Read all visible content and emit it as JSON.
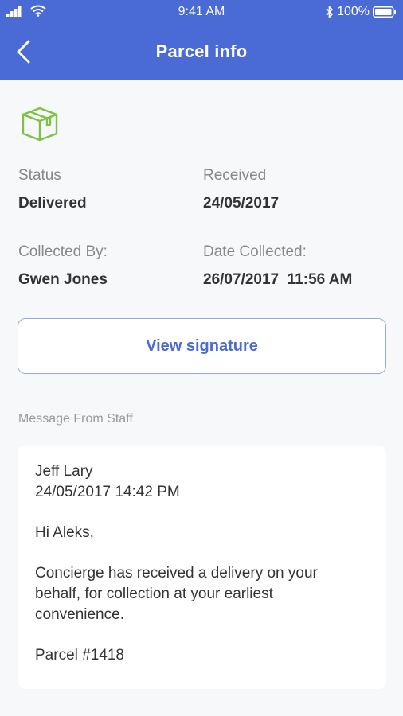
{
  "status_bar": {
    "time": "9:41 AM",
    "battery": "100%"
  },
  "nav": {
    "title": "Parcel info",
    "back_icon": "chevron-left-icon"
  },
  "parcel": {
    "icon": "package-icon",
    "icon_color": "#7cc243",
    "fields": {
      "status_label": "Status",
      "status_value": "Delivered",
      "received_label": "Received",
      "received_value": "24/05/2017",
      "collected_by_label": "Collected By:",
      "collected_by_value": "Gwen Jones",
      "date_collected_label": "Date Collected:",
      "date_collected_value": "26/07/2017  11:56 AM"
    },
    "view_signature_label": "View signature"
  },
  "message": {
    "heading": "Message From Staff",
    "sender": "Jeff Lary",
    "timestamp": "24/05/2017 14:42 PM",
    "greeting": "Hi Aleks,",
    "body_lines": [
      "Concierge has received a delivery on your",
      "behalf, for collection at your earliest",
      "convenience."
    ],
    "parcel_ref": "Parcel #1418"
  },
  "colors": {
    "accent": "#4a6ad6",
    "background": "#f7f8fa"
  }
}
